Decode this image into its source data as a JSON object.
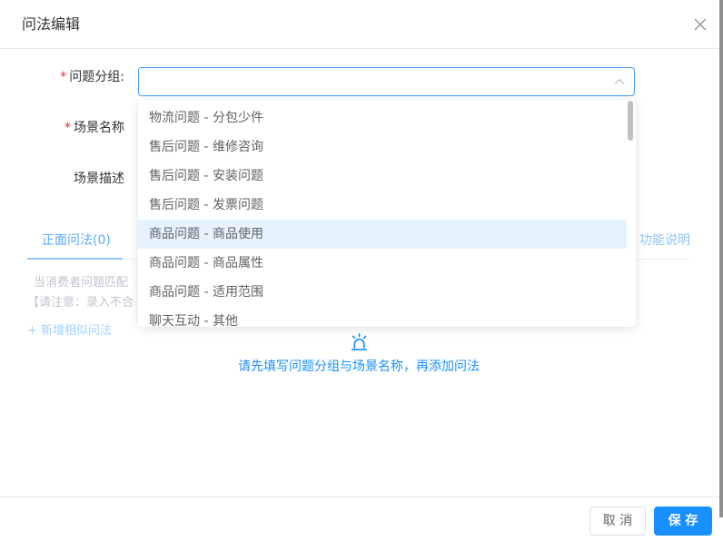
{
  "dialog": {
    "title": "问法编辑",
    "close_icon": "close-icon"
  },
  "form": {
    "required_mark": "*",
    "group": {
      "label": "问题分组:",
      "value": "",
      "icon": "chevron-up-icon"
    },
    "scene_name": {
      "label": "场景名称"
    },
    "scene_desc": {
      "label": "场景描述"
    }
  },
  "dropdown": {
    "options": [
      "物流问题 - 分包少件",
      "售后问题 - 维修咨询",
      "售后问题 - 安装问题",
      "售后问题 - 发票问题",
      "商品问题 - 商品使用",
      "商品问题 - 商品属性",
      "商品问题 - 适用范围",
      "聊天互动 - 其他"
    ],
    "highlighted_index": 4
  },
  "tabs": {
    "positive": "正面问法(0)",
    "help": "功能说明"
  },
  "tips": {
    "line1": "当消费者问题匹配",
    "line2": "【请注意：录入不合",
    "add_link": "+ 新增相似问法"
  },
  "empty_state": {
    "icon": "alarm-icon",
    "text": "请先填写问题分组与场景名称，再添加问法"
  },
  "footer": {
    "cancel": "取 消",
    "save": "保 存"
  },
  "colors": {
    "primary": "#1890ff",
    "required": "#f5222d",
    "tab_active": "#5aaaf5",
    "link_faded": "#a0cfff",
    "option_hover": "#e6f3fd"
  }
}
